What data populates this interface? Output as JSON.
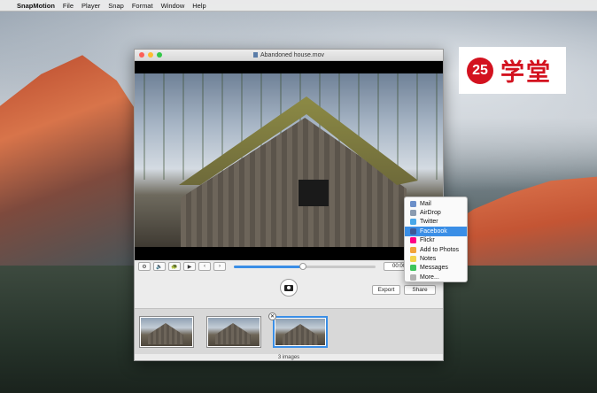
{
  "menubar": {
    "app_name": "SnapMotion",
    "items": [
      "File",
      "Player",
      "Snap",
      "Format",
      "Window",
      "Help"
    ]
  },
  "watermark": {
    "number": "25",
    "text": "学堂"
  },
  "window": {
    "title": "Abandoned house.mov",
    "controls": {
      "timecode": "00:00:0",
      "progress_fraction": 0.49
    },
    "buttons": {
      "export": "Export",
      "share": "Share"
    },
    "status": "3 images"
  },
  "share_menu": {
    "items": [
      {
        "label": "Mail",
        "color": "#6b8fc9"
      },
      {
        "label": "AirDrop",
        "color": "#8a9bb0"
      },
      {
        "label": "Twitter",
        "color": "#48a7e8"
      },
      {
        "label": "Facebook",
        "color": "#3b5998",
        "highlighted": true
      },
      {
        "label": "Flickr",
        "color": "#ff0084"
      },
      {
        "label": "Add to Photos",
        "color": "#f2a33a"
      },
      {
        "label": "Notes",
        "color": "#f3d34a"
      },
      {
        "label": "Messages",
        "color": "#3ec45b"
      },
      {
        "label": "More...",
        "color": "#b0b0b0"
      }
    ]
  },
  "icons": {
    "gear": "gear-icon",
    "volume": "volume-icon",
    "turtle": "turtle-icon",
    "play": "play-icon",
    "prev": "previous-frame-icon",
    "next": "next-frame-icon",
    "camera": "camera-icon"
  }
}
